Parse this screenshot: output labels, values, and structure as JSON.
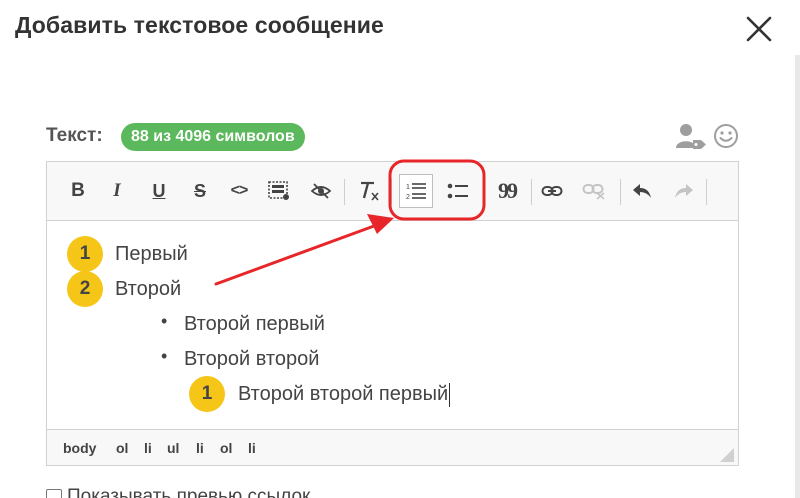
{
  "dialog": {
    "title": "Добавить текстовое сообщение"
  },
  "editor": {
    "label": "Текст:",
    "counter": "88 из 4096 символов",
    "content": {
      "items": [
        {
          "marker": "1",
          "text": "Первый"
        },
        {
          "marker": "2",
          "text": "Второй"
        },
        {
          "marker": "•",
          "text": "Второй первый"
        },
        {
          "marker": "•",
          "text": "Второй второй"
        },
        {
          "marker": "1",
          "text": "Второй второй первый"
        }
      ]
    },
    "path": [
      "body",
      "ol",
      "li",
      "ul",
      "li",
      "ol",
      "li"
    ]
  },
  "toolbar": {
    "bold": "B",
    "italic": "I",
    "underline": "U",
    "strike": "S",
    "code": "<>",
    "quote": "99"
  },
  "bottom": {
    "checkbox_label": "Показывать превью ссылок"
  },
  "colors": {
    "badge_green": "#5cb85c",
    "list_marker_yellow": "#f5c518",
    "annotation_red": "#e8262a"
  },
  "icons": {
    "close": "close-icon",
    "user": "user-tag-icon",
    "emoji": "smiley-icon",
    "ordered_list": "ordered-list-icon",
    "unordered_list": "unordered-list-icon"
  }
}
